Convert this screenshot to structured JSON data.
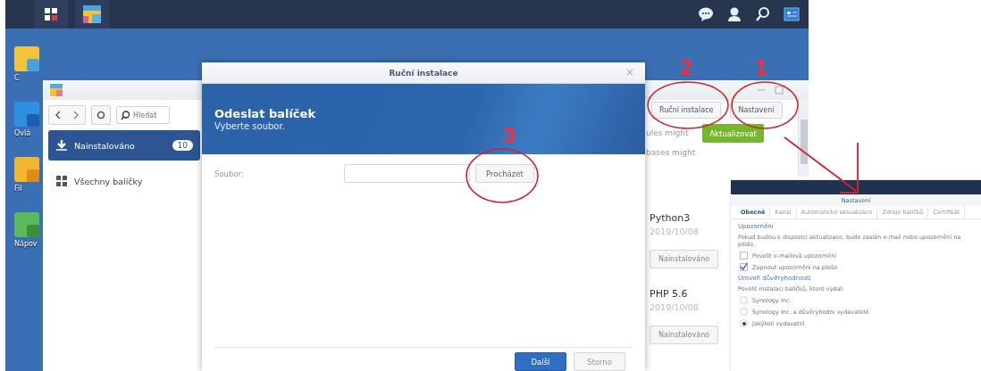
{
  "desktop_icons": [
    {
      "label": "C"
    },
    {
      "label": "Ovlá"
    },
    {
      "label": "Fil"
    },
    {
      "label": "Nápov"
    }
  ],
  "package_center": {
    "search": {
      "placeholder": "Hledat"
    },
    "sidebar": {
      "items": [
        {
          "label": "Nainstalováno",
          "count": "10",
          "selected": true
        },
        {
          "label": "Všechny balíčky",
          "selected": false
        }
      ]
    },
    "buttons": [
      "Ruční instalace",
      "Nastavení"
    ],
    "notice_lines": [
      "ules might",
      "bases might"
    ],
    "update_button": "Aktualizovat",
    "packages": [
      {
        "name": "Python3",
        "date": "2019/10/08",
        "button": "Nainstalováno"
      },
      {
        "name": "PHP 5.6",
        "date": "2019/10/08",
        "button": "Nainstalováno"
      }
    ]
  },
  "dialog": {
    "title": "Ruční instalace",
    "close": "×",
    "heading": "Odeslat balíček",
    "subheading": "Vyberte soubor.",
    "field_label": "Soubor:",
    "browse_button": "Procházet",
    "buttons": [
      {
        "label": "Další",
        "kind": "primary"
      },
      {
        "label": "Storno",
        "kind": "secondary"
      }
    ]
  },
  "settings_inset": {
    "title": "Nastavení",
    "tabs": [
      {
        "label": "Obecné",
        "selected": true
      },
      {
        "label": "Kanál",
        "selected": false
      },
      {
        "label": "Automatické aktualizace",
        "selected": false
      },
      {
        "label": "Zdroje balíčků",
        "selected": false
      },
      {
        "label": "Certifikát",
        "selected": false
      }
    ],
    "sections": [
      {
        "title": "Upozornění",
        "description": "Pokud budou k dispozici aktualizace, bude zaslán e-mail nebo upozornění na ploše.",
        "options": [
          {
            "kind": "checkbox",
            "label": "Povolit e-mailová upozornění",
            "checked": false
          },
          {
            "kind": "checkbox",
            "label": "Zapnout upozornění na ploše",
            "checked": true
          }
        ]
      },
      {
        "title": "Úroveň důvěryhodnosti",
        "description": "Povolit instalaci balíčků, které vydal:",
        "options": [
          {
            "kind": "radio",
            "label": "Synology Inc.",
            "selected": false
          },
          {
            "kind": "radio",
            "label": "Synology Inc. a důvěryhodní vydavatelé",
            "selected": false
          },
          {
            "kind": "radio",
            "label": "Jakýkoli vydavatel",
            "selected": true
          }
        ]
      }
    ]
  },
  "annotations": [
    {
      "label": "1"
    },
    {
      "label": "2"
    },
    {
      "label": "3"
    }
  ]
}
